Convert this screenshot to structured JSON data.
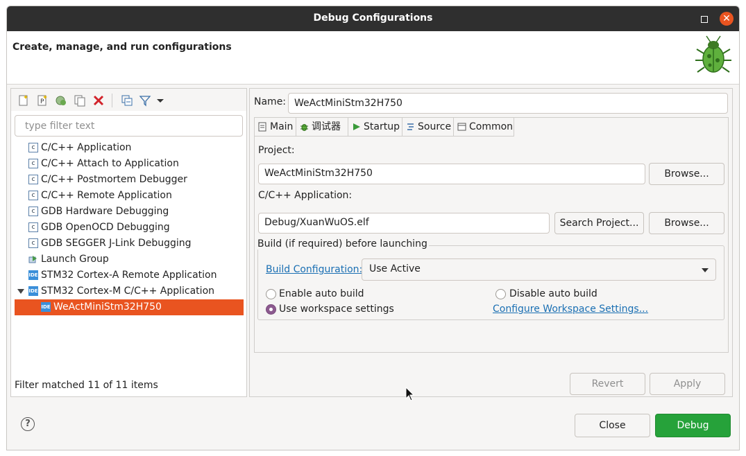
{
  "window": {
    "title": "Debug Configurations"
  },
  "header": {
    "description": "Create, manage, and run configurations"
  },
  "filter": {
    "placeholder": "type filter text",
    "status": "Filter matched 11 of 11 items"
  },
  "tree": {
    "items": [
      {
        "label": "C/C++ Application",
        "icon": "c-config-icon"
      },
      {
        "label": "C/C++ Attach to Application",
        "icon": "c-config-icon"
      },
      {
        "label": "C/C++ Postmortem Debugger",
        "icon": "c-config-icon"
      },
      {
        "label": "C/C++ Remote Application",
        "icon": "c-config-icon"
      },
      {
        "label": "GDB Hardware Debugging",
        "icon": "c-config-icon"
      },
      {
        "label": "GDB OpenOCD Debugging",
        "icon": "c-config-icon"
      },
      {
        "label": "GDB SEGGER J-Link Debugging",
        "icon": "c-config-icon"
      },
      {
        "label": "Launch Group",
        "icon": "launch-group-icon"
      },
      {
        "label": "STM32 Cortex-A Remote Application",
        "icon": "ide-icon"
      },
      {
        "label": "STM32 Cortex-M C/C++ Application",
        "icon": "ide-icon",
        "expanded": true
      },
      {
        "label": "WeActMiniStm32H750",
        "icon": "ide-icon",
        "selected": true
      }
    ]
  },
  "config": {
    "name_label": "Name:",
    "name_value": "WeActMiniStm32H750",
    "tabs": [
      {
        "label": "Main",
        "active": true
      },
      {
        "label": "调试器"
      },
      {
        "label": "Startup"
      },
      {
        "label": "Source"
      },
      {
        "label": "Common"
      }
    ],
    "project_label": "Project:",
    "project_value": "WeActMiniStm32H750",
    "browse_label": "Browse...",
    "app_label": "C/C++ Application:",
    "app_value": "Debug/XuanWuOS.elf",
    "search_project_label": "Search Project...",
    "build_group_title": "Build (if required) before launching",
    "build_config_link": "Build Configuration:",
    "build_config_value": "Use Active",
    "enable_auto_build": "Enable auto build",
    "disable_auto_build": "Disable auto build",
    "use_workspace_settings": "Use workspace settings",
    "configure_workspace_link": "Configure Workspace Settings...",
    "build_option_selected": "Use workspace settings",
    "revert_label": "Revert",
    "apply_label": "Apply"
  },
  "footer": {
    "close_label": "Close",
    "debug_label": "Debug"
  },
  "colors": {
    "selection": "#e95420",
    "debug_button": "#26a23a",
    "title_bar": "#2f2f2f",
    "link": "#1a6fb3"
  }
}
